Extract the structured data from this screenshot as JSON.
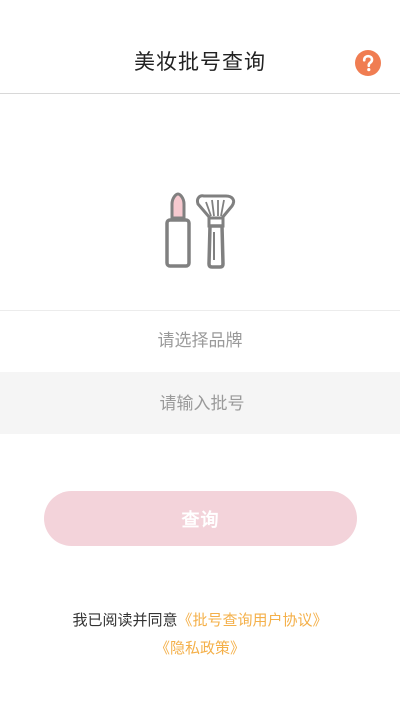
{
  "header": {
    "title": "美妆批号查询",
    "help_icon": "question-circle-icon",
    "help_color": "#f07d52"
  },
  "hero": {
    "icon": "lipstick-and-brush-icon",
    "accent_color": "#f6c9cf",
    "stroke_color": "#808080"
  },
  "form": {
    "brand_placeholder": "请选择品牌",
    "batch_placeholder": "请输入批号",
    "batch_value": ""
  },
  "query_button": {
    "label": "查询",
    "color": "#f3d3da"
  },
  "agreement": {
    "prefix": "我已阅读并同意",
    "user_agreement": "《批号查询用户协议》",
    "privacy_policy": "《隐私政策》",
    "link_color": "#f4b04a"
  }
}
